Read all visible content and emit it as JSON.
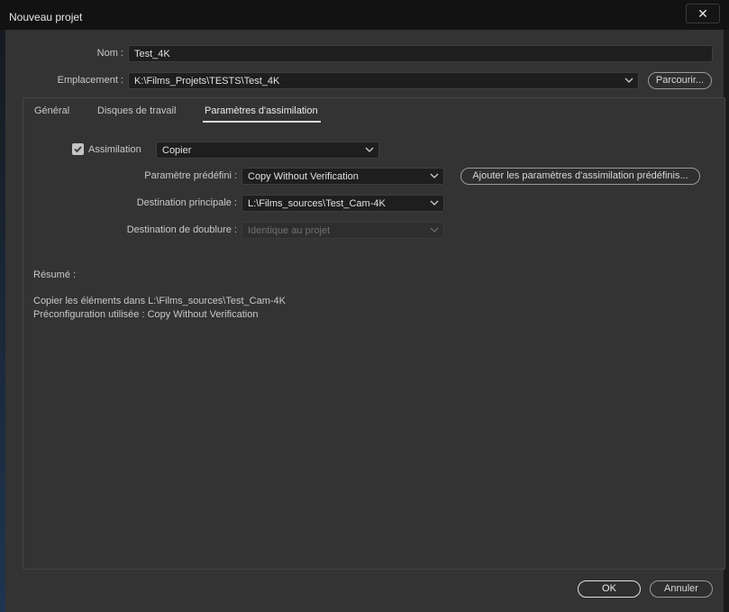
{
  "window": {
    "title": "Nouveau projet",
    "close_icon": "close-icon"
  },
  "form": {
    "name_label": "Nom :",
    "name_value": "Test_4K",
    "location_label": "Emplacement :",
    "location_value": "K:\\Films_Projets\\TESTS\\Test_4K",
    "browse_button": "Parcourir..."
  },
  "tabs": [
    {
      "label": "Général",
      "active": false
    },
    {
      "label": "Disques de travail",
      "active": false
    },
    {
      "label": "Paramètres d'assimilation",
      "active": true
    }
  ],
  "ingest": {
    "enabled": true,
    "checkbox_label": "Assimilation",
    "mode_value": "Copier",
    "preset_label": "Paramètre prédéfini :",
    "preset_value": "Copy Without Verification",
    "add_preset_button": "Ajouter les paramètres d'assimilation prédéfinis...",
    "primary_dest_label": "Destination principale :",
    "primary_dest_value": "L:\\Films_sources\\Test_Cam-4K",
    "duplicate_dest_label": "Destination de doublure :",
    "duplicate_dest_value": "Identique au projet"
  },
  "summary": {
    "heading": "Résumé :",
    "line1": "Copier les éléments dans L:\\Films_sources\\Test_Cam-4K",
    "line2": "Préconfiguration utilisée : Copy Without Verification"
  },
  "footer": {
    "ok_button": "OK",
    "cancel_button": "Annuler"
  },
  "colors": {
    "background": "#333333",
    "titlebar": "#121212",
    "field": "#1e1e1e"
  }
}
